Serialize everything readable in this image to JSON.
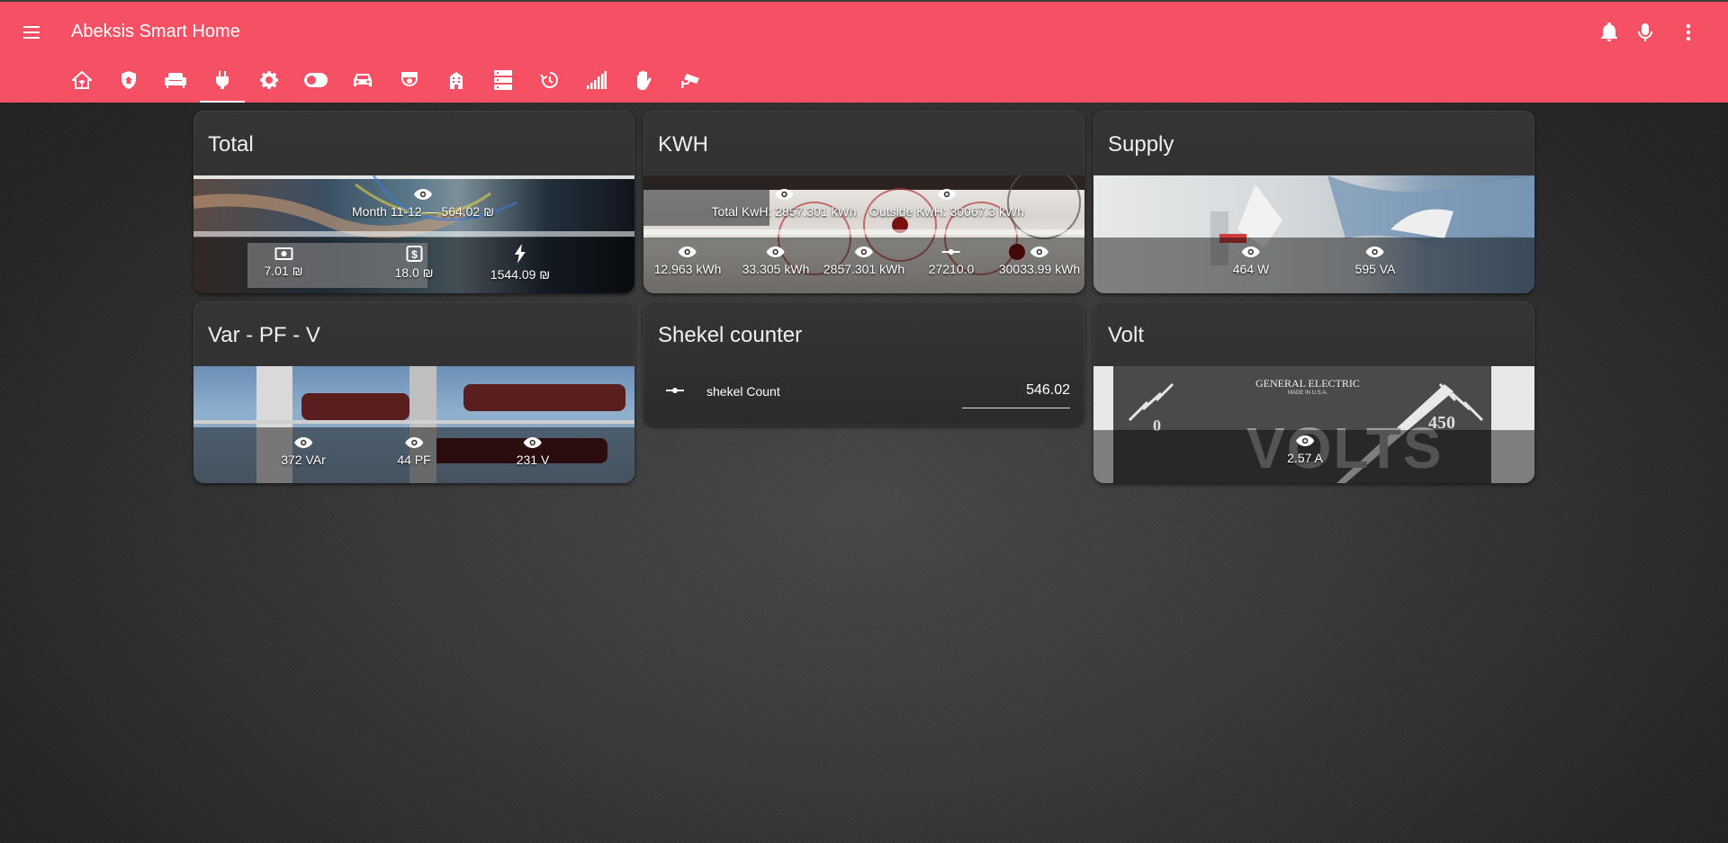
{
  "app": {
    "title": "Abeksis Smart Home"
  },
  "header": {
    "menu_icon": "menu-icon",
    "right_icons": [
      "bell-icon",
      "microphone-icon",
      "more-vertical-icon"
    ],
    "tabs": [
      {
        "icon": "home-assistant-icon"
      },
      {
        "icon": "shield-home-icon"
      },
      {
        "icon": "sofa-icon"
      },
      {
        "icon": "power-plug-icon",
        "active": true
      },
      {
        "icon": "gear-icon"
      },
      {
        "icon": "toggle-switch-icon"
      },
      {
        "icon": "car-icon"
      },
      {
        "icon": "cctv-icon"
      },
      {
        "icon": "building-icon"
      },
      {
        "icon": "server-icon"
      },
      {
        "icon": "history-icon"
      },
      {
        "icon": "signal-icon"
      },
      {
        "icon": "hand-icon"
      },
      {
        "icon": "camera-icon"
      }
    ]
  },
  "cards": {
    "total": {
      "title": "Total",
      "top_stat": "Month 11-12 — 564.02 ₪",
      "stats": [
        "7.01 ₪",
        "18.0 ₪",
        "1544.09 ₪"
      ]
    },
    "kwh": {
      "title": "KWH",
      "top_stats": [
        "Total KwH: 2857.301 kWh",
        "Outside KwH: 30067.3 kWh"
      ],
      "stats": [
        "12.963 kWh",
        "33.305 kWh",
        "2857.301 kWh",
        "27210.0",
        "30033.99 kWh"
      ]
    },
    "supply": {
      "title": "Supply",
      "stats": [
        "464 W",
        "595 VA"
      ]
    },
    "varpfv": {
      "title": "Var - PF - V",
      "stats": [
        "372 VAr",
        "44 PF",
        "231 V"
      ]
    },
    "shekel": {
      "title": "Shekel counter",
      "entity_label": "shekel Count",
      "entity_value": "546.02"
    },
    "volt": {
      "title": "Volt",
      "stats": [
        "2.57 A"
      ],
      "gauge_brand": "GENERAL ELECTRIC",
      "gauge_made": "MADE IN U.S.A.",
      "gauge_text": "VOLTS",
      "gauge_min": "0",
      "gauge_max": "450"
    }
  },
  "colors": {
    "header": "#f55064",
    "card": "#303030",
    "text": "#ffffff"
  }
}
